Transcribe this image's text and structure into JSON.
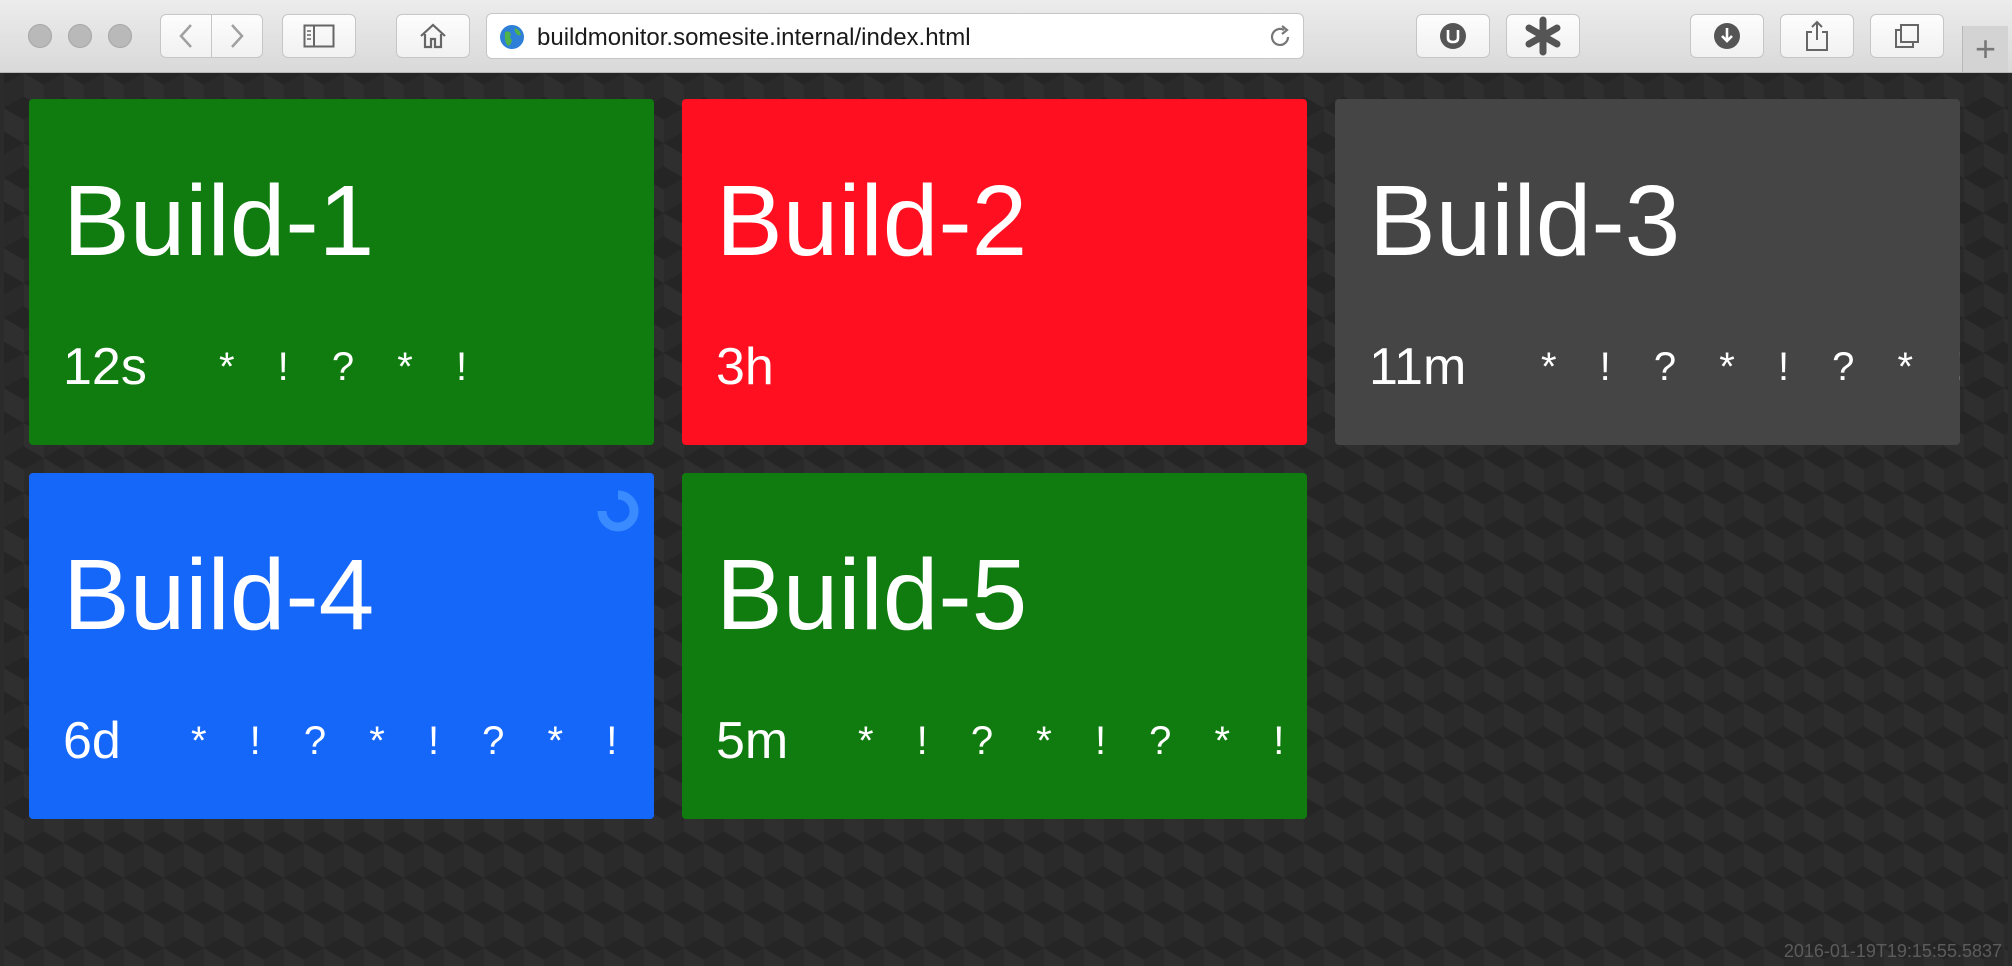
{
  "browser": {
    "url": "buildmonitor.somesite.internal/index.html",
    "new_tab_label": "+"
  },
  "tiles": [
    {
      "name": "Build-1",
      "duration": "12s",
      "culprits": "* ! ? * !",
      "status": "success",
      "color": "#107c10"
    },
    {
      "name": "Build-2",
      "duration": "3h",
      "culprits": "",
      "status": "failure",
      "color": "#ff0f1f"
    },
    {
      "name": "Build-3",
      "duration": "11m",
      "culprits": "* ! ? * ! ? * ! ? *",
      "status": "unknown",
      "color": "#454545"
    },
    {
      "name": "Build-4",
      "duration": "6d",
      "culprits": "* ! ? * ! ? * ! ? *",
      "status": "building",
      "color": "#1567f9"
    },
    {
      "name": "Build-5",
      "duration": "5m",
      "culprits": "* ! ? * ! ? * ! ? *",
      "status": "success",
      "color": "#107c10"
    }
  ],
  "timestamp": "2016-01-19T19:15:55.5837"
}
